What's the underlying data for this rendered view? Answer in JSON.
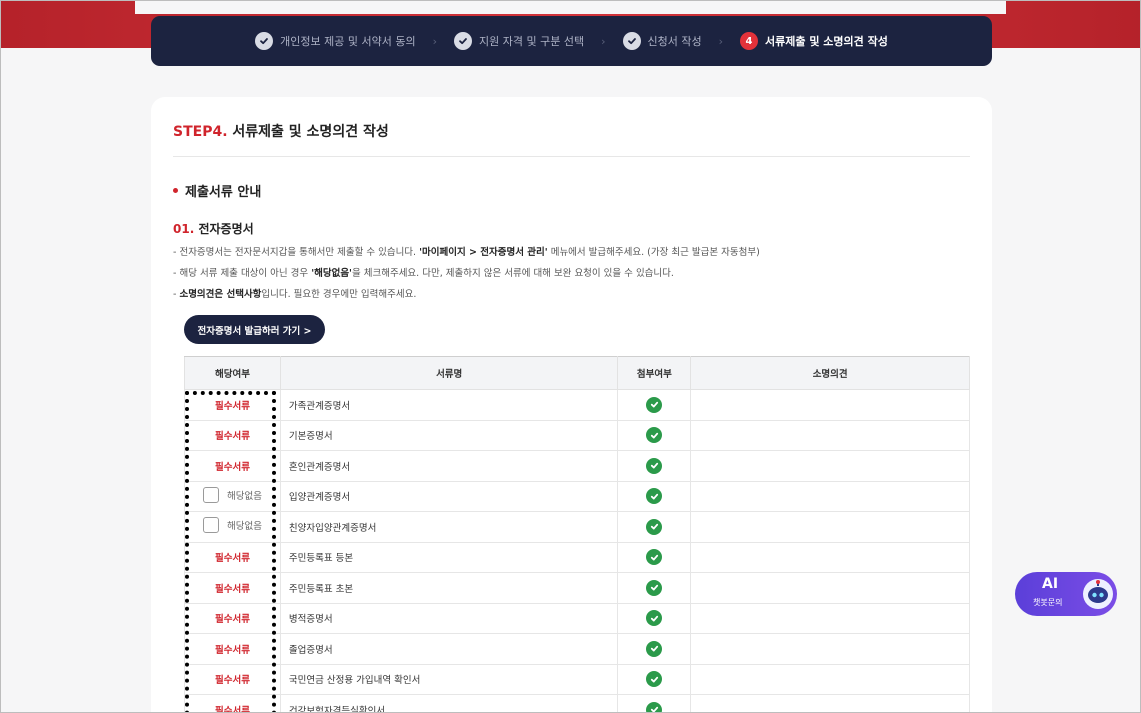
{
  "steps": [
    {
      "label": "개인정보 제공 및 서약서 동의",
      "state": "done"
    },
    {
      "label": "지원 자격 및 구분 선택",
      "state": "done"
    },
    {
      "label": "신청서 작성",
      "state": "done"
    },
    {
      "number": "4",
      "label": "서류제출 및 소명의견 작성",
      "state": "active"
    }
  ],
  "card": {
    "step_label": "STEP4.",
    "title": "서류제출 및 소명의견 작성",
    "section_title": "제출서류 안내",
    "sub_idx": "01.",
    "sub_title": "전자증명서",
    "desc1_a": "- 전자증명서는 전자문서지갑을 통해서만 제출할 수 있습니다. ",
    "desc1_b": "'마이페이지 > 전자증명서 관리'",
    "desc1_c": " 메뉴에서 발급해주세요. (가장 최근 발급본 자동첨부)",
    "desc2_a": "- 해당 서류 제출 대상이 아닌 경우 ",
    "desc2_b": "'해당없음'",
    "desc2_c": "을 체크해주세요. 다만, 제출하지 않은 서류에 대해 보완 요청이 있을 수 있습니다.",
    "desc3_a": "- ",
    "desc3_b": "소명의견은 선택사항",
    "desc3_c": "입니다. 필요한 경우에만 입력해주세요.",
    "button": "전자증명서 발급하러 가기 >"
  },
  "table": {
    "headers": [
      "해당여부",
      "서류명",
      "첨부여부",
      "소명의견"
    ],
    "required_label": "필수서류",
    "na_label": "해당없음",
    "rows": [
      {
        "kind": "required",
        "name": "가족관계증명서",
        "attached": true
      },
      {
        "kind": "required",
        "name": "기본증명서",
        "attached": true
      },
      {
        "kind": "required",
        "name": "혼인관계증명서",
        "attached": true
      },
      {
        "kind": "na",
        "name": "입양관계증명서",
        "attached": true
      },
      {
        "kind": "na",
        "name": "친양자입양관계증명서",
        "attached": true
      },
      {
        "kind": "required",
        "name": "주민등록표 등본",
        "attached": true
      },
      {
        "kind": "required",
        "name": "주민등록표 초본",
        "attached": true
      },
      {
        "kind": "required",
        "name": "병적증명서",
        "attached": true
      },
      {
        "kind": "required",
        "name": "졸업증명서",
        "attached": true
      },
      {
        "kind": "required",
        "name": "국민연금 산정용 가입내역 확인서",
        "attached": true
      },
      {
        "kind": "required",
        "name": "건강보험자격득실확인서",
        "attached": true
      }
    ]
  },
  "ai_widget": {
    "title": "AI",
    "subtitle": "챗봇문의"
  },
  "colors": {
    "accent_red": "#d0242c",
    "navy": "#1c2340",
    "green": "#2b9a4a",
    "purple": "#6a45e0"
  }
}
